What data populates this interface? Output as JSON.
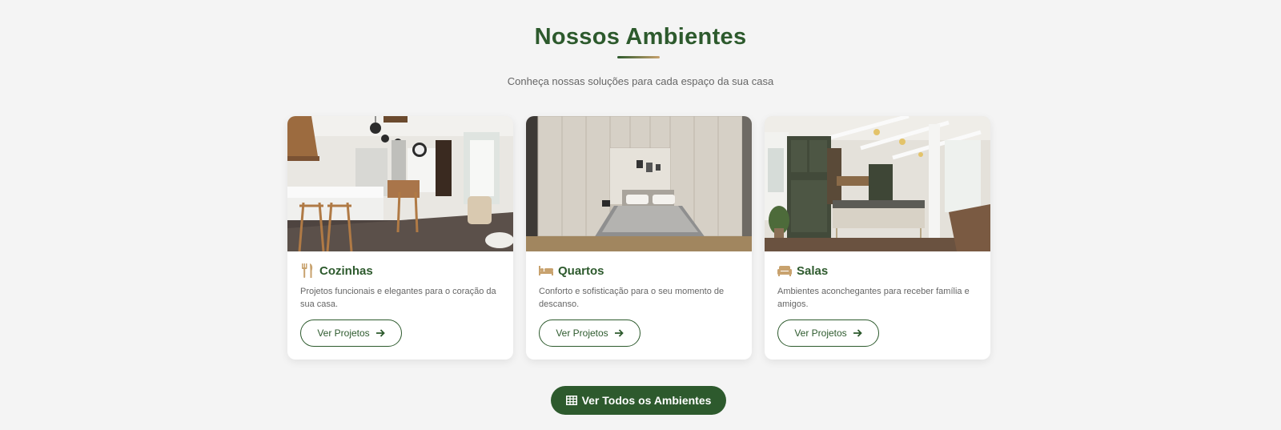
{
  "section": {
    "title": "Nossos Ambientes",
    "subtitle": "Conheça nossas soluções para cada espaço da sua casa"
  },
  "cards": [
    {
      "icon": "utensils-icon",
      "title": "Cozinhas",
      "description": "Projetos funcionais e elegantes para o coração da sua casa.",
      "button_label": "Ver Projetos",
      "image": "kitchen-photo"
    },
    {
      "icon": "bed-icon",
      "title": "Quartos",
      "description": "Conforto e sofisticação para o seu momento de descanso.",
      "button_label": "Ver Projetos",
      "image": "bedroom-photo"
    },
    {
      "icon": "couch-icon",
      "title": "Salas",
      "description": "Ambientes aconchegantes para receber família e amigos.",
      "button_label": "Ver Projetos",
      "image": "living-room-photo"
    }
  ],
  "cta": {
    "label": "Ver Todos os Ambientes",
    "icon": "table-grid-icon"
  },
  "colors": {
    "brand_green": "#2d5a2d",
    "accent_gold": "#c8a26e",
    "background": "#f4f4f4"
  }
}
